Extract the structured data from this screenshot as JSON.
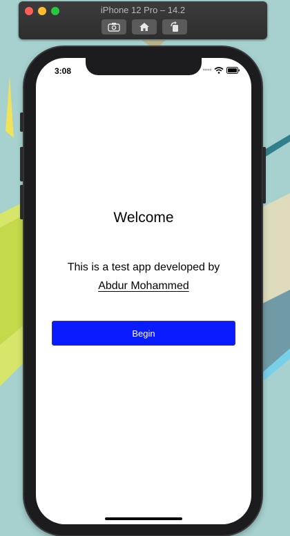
{
  "simulator": {
    "title": "iPhone 12 Pro – 14.2",
    "controls": [
      "screenshot-icon",
      "home-icon",
      "rotate-icon"
    ]
  },
  "status_bar": {
    "time": "3:08"
  },
  "app": {
    "heading": "Welcome",
    "description": "This is a test app developed by",
    "author": "Abdur Mohammed",
    "button_label": "Begin"
  },
  "colors": {
    "button": "#0a1cff",
    "background": "#ffffff",
    "desktop": "#a9d3d0"
  }
}
